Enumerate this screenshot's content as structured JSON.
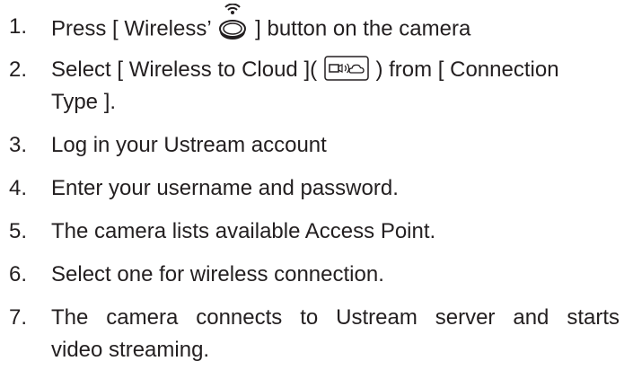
{
  "steps": [
    {
      "number": "1.",
      "before_icon": "Press [ Wireless’",
      "icon": "wireless-button-icon",
      "after_icon": "] button on the camera"
    },
    {
      "number": "2.",
      "before_icon": "Select [ Wireless to Cloud ](",
      "icon": "camera-to-cloud-icon",
      "after_icon": ") from [ Connection",
      "line2": "Type ]."
    },
    {
      "number": "3.",
      "text": "Log in your Ustream account"
    },
    {
      "number": "4.",
      "text": "Enter your username and password."
    },
    {
      "number": "5.",
      "text": "The camera lists available Access Point."
    },
    {
      "number": "6.",
      "text": "Select one for wireless connection."
    },
    {
      "number": "7.",
      "line1": "The camera connects to Ustream server and starts",
      "line2": "video streaming."
    }
  ],
  "colors": {
    "text": "#231f20",
    "icon": "#231f20",
    "background": "#ffffff"
  }
}
